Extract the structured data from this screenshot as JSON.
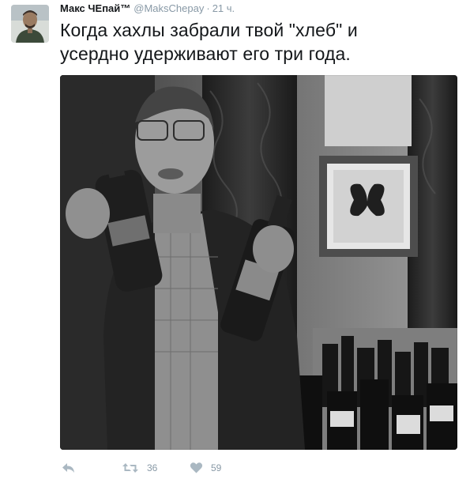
{
  "tweet": {
    "display_name": "Макс ЧЕпай™",
    "screen_name": "@MaksChepay",
    "separator": "·",
    "time": "21 ч.",
    "text": "Когда хахлы забрали твой \"хлеб\" и усердно удерживают его три года.",
    "avatar_icon": "user-avatar",
    "photo_subject": "photo-man-holding-whisky-bottles"
  },
  "actions": {
    "reply_icon": "reply-icon",
    "retweet_icon": "retweet-icon",
    "retweet_count": "36",
    "like_icon": "heart-icon",
    "like_count": "59"
  },
  "colors": {
    "text": "#14171a",
    "muted": "#8899a6",
    "icon": "#aab8c2"
  }
}
